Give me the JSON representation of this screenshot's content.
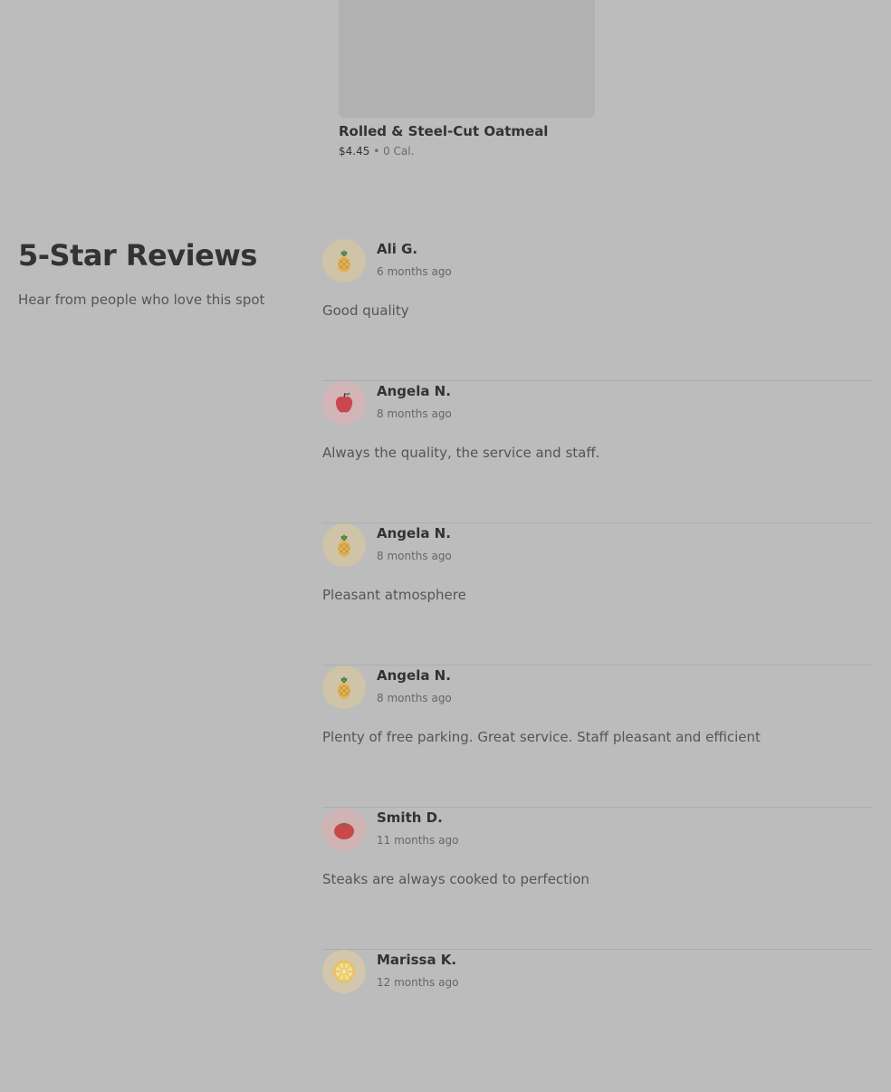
{
  "menu_item": {
    "name": "Rolled & Steel-Cut Oatmeal",
    "price": "$4.45",
    "separator": "•",
    "calories": "0 Cal."
  },
  "reviews_section": {
    "title": "5-Star Reviews",
    "subtitle": "Hear from people who love this spot"
  },
  "reviews": [
    {
      "name": "Ali G.",
      "date": "6 months ago",
      "text": "Good quality",
      "avatar_icon": "pineapple-icon",
      "avatar_bg": "#cfc3a8"
    },
    {
      "name": "Angela N.",
      "date": "8 months ago",
      "text": "Always the quality, the service and staff.",
      "avatar_icon": "apple-icon",
      "avatar_bg": "#d3b5b8"
    },
    {
      "name": "Angela N.",
      "date": "8 months ago",
      "text": "Pleasant atmosphere",
      "avatar_icon": "pineapple-icon",
      "avatar_bg": "#cfc3a8"
    },
    {
      "name": "Angela N.",
      "date": "8 months ago",
      "text": "Plenty of free parking. Great service. Staff pleasant and efficient",
      "avatar_icon": "pineapple-icon",
      "avatar_bg": "#cfc3a8"
    },
    {
      "name": "Smith D.",
      "date": "11 months ago",
      "text": "Steaks are always cooked to perfection",
      "avatar_icon": "tomato-icon",
      "avatar_bg": "#d0b4b4"
    },
    {
      "name": "Marissa K.",
      "date": "12 months ago",
      "text": "",
      "avatar_icon": "lemon-slice-icon",
      "avatar_bg": "#d2c6ad"
    }
  ]
}
